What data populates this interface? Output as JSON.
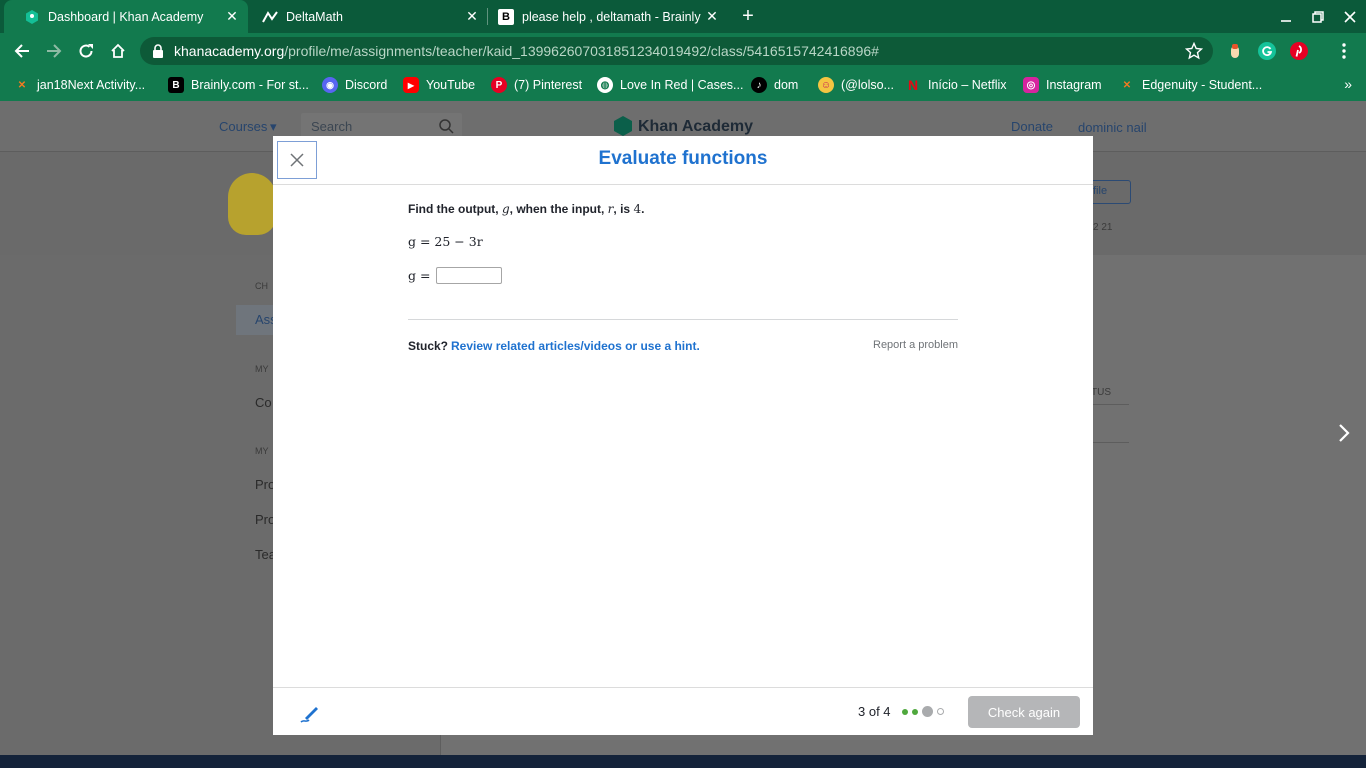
{
  "tabs": [
    {
      "title": "Dashboard | Khan Academy"
    },
    {
      "title": "DeltaMath"
    },
    {
      "title": "please help , deltamath - Brainly"
    }
  ],
  "address": {
    "host": "khanacademy.org",
    "path": "/profile/me/assignments/teacher/kaid_1399626070318512340194​92/class/5416515742416896#"
  },
  "bookmarks": [
    {
      "label": "jan18Next Activity..."
    },
    {
      "label": "Brainly.com - For st..."
    },
    {
      "label": "Discord"
    },
    {
      "label": "YouTube"
    },
    {
      "label": "(7) Pinterest"
    },
    {
      "label": "Love In Red | Cases..."
    },
    {
      "label": "dom"
    },
    {
      "label": "(@lolso..."
    },
    {
      "label": "Início – Netflix"
    },
    {
      "label": "Instagram"
    },
    {
      "label": "Edgenuity - Student..."
    }
  ],
  "background_page": {
    "nav_courses": "Courses",
    "search_placeholder": "Search",
    "logo": "Khan Academy",
    "donate": "Donate",
    "user": "dominic nail",
    "profile_btn": "file",
    "stats": "2  21",
    "side_labels": [
      "CH",
      "Ass",
      "MY",
      "Co",
      "MY",
      "Pro",
      "Pro",
      "Tea"
    ],
    "status_col": "TUS"
  },
  "modal": {
    "title": "Evaluate functions",
    "question_prefix": "Find the output, ",
    "var_output": "g",
    "question_mid": ", when the input, ",
    "var_input": "r",
    "question_mid2": ", is ",
    "input_value": "4",
    "question_end": ".",
    "equation": "g = 25 − 3r",
    "answer_label": "g =",
    "answer_value": "",
    "stuck_label": "Stuck?",
    "stuck_link": "Review related articles/videos or use a hint.",
    "report": "Report a problem",
    "progress": "3 of 4",
    "progress_current": 3,
    "progress_total": 4,
    "check_button": "Check again"
  },
  "colors": {
    "chrome_dark": "#0b5a3a",
    "chrome": "#127a4e",
    "ka_blue": "#1f72cf",
    "dot_done": "#4fa83d",
    "button_disabled": "#b5b6b8"
  }
}
